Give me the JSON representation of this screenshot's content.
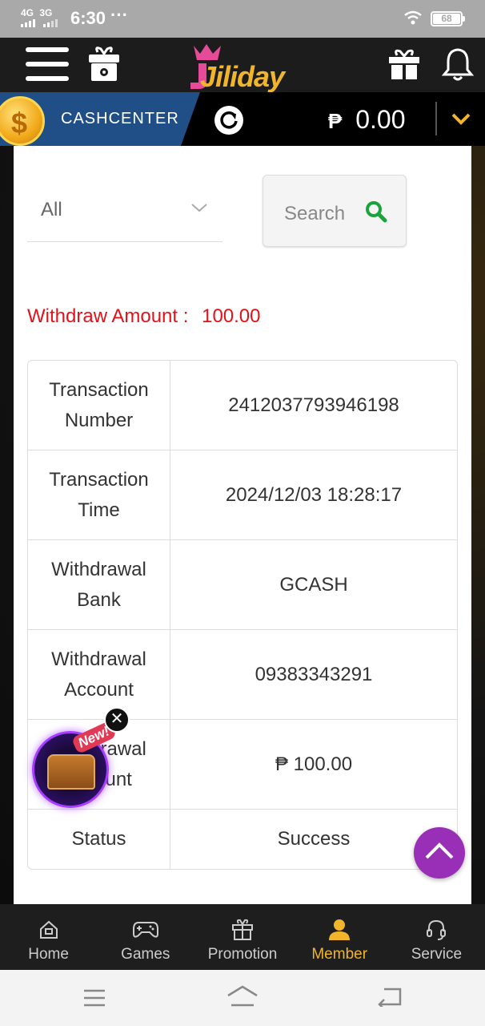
{
  "status_bar": {
    "network_1": "4G",
    "network_2": "3G",
    "time": "6:30",
    "dots": "···",
    "battery": "68"
  },
  "header": {
    "logo_text": "Jiliday",
    "menu_icon": "hamburger-menu-icon",
    "gift_box_icon": "gift-box-icon",
    "present_icon": "present-icon",
    "bell_icon": "bell-icon"
  },
  "cash_bar": {
    "label": "CASHCENTER",
    "currency": "₱",
    "balance": "0.00"
  },
  "filter": {
    "selected": "All"
  },
  "search": {
    "label": "Search"
  },
  "summary": {
    "withdraw_label": "Withdraw Amount :",
    "withdraw_value": "100.00"
  },
  "table": {
    "rows": [
      {
        "label": "Transaction Number",
        "value": "2412037793946198"
      },
      {
        "label": "Transaction Time",
        "value": "2024/12/03 18:28:17"
      },
      {
        "label": "Withdrawal Bank",
        "value": "GCASH"
      },
      {
        "label": "Withdrawal Account",
        "value": "09383343291"
      },
      {
        "label": "Withdrawal Amount",
        "value": "₱ 100.00"
      },
      {
        "label": "Status",
        "value": "Success"
      }
    ]
  },
  "promo": {
    "badge": "New!"
  },
  "bottom_nav": {
    "items": [
      {
        "label": "Home",
        "icon": "home-icon"
      },
      {
        "label": "Games",
        "icon": "gamepad-icon"
      },
      {
        "label": "Promotion",
        "icon": "gift-icon"
      },
      {
        "label": "Member",
        "icon": "member-icon"
      },
      {
        "label": "Service",
        "icon": "headset-icon"
      }
    ],
    "active": "Member"
  },
  "colors": {
    "accent": "#f0b52a",
    "alert_red": "#e0131a",
    "search_green": "#1aa33a",
    "scroll_purple": "#9a2fb7",
    "cash_blue": "#1f4f86"
  }
}
